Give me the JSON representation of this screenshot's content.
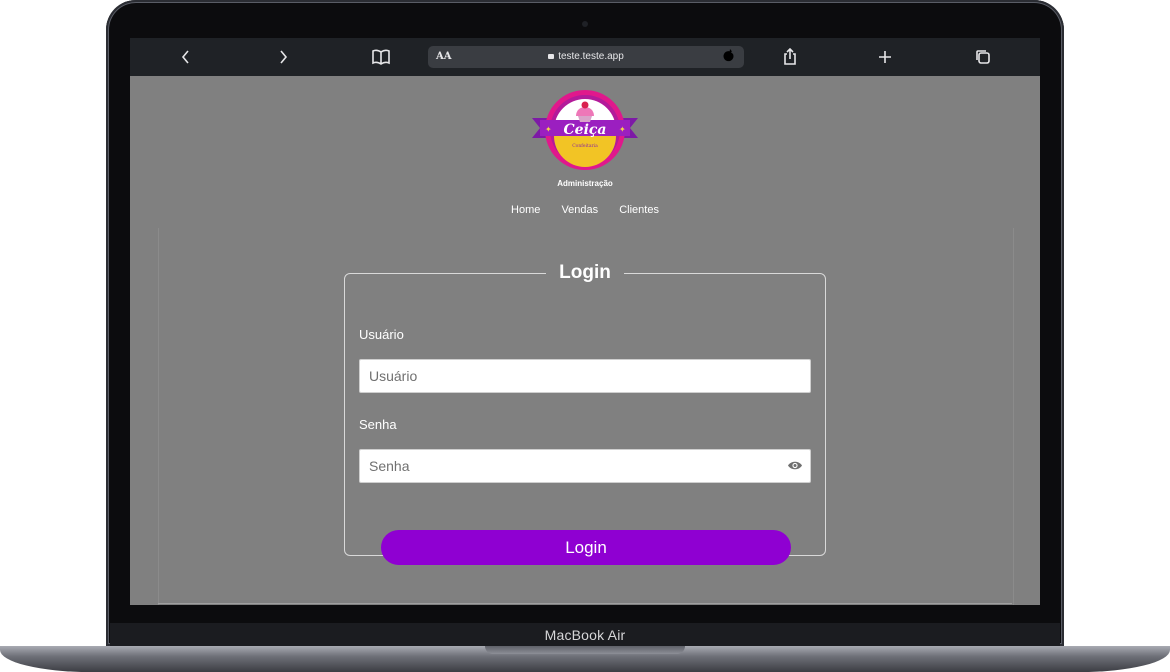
{
  "device": {
    "model_label": "MacBook Air"
  },
  "browser": {
    "text_size_label": "AA",
    "url": "teste.teste.app",
    "icons": {
      "back": "chevron-left-icon",
      "forward": "chevron-right-icon",
      "bookmarks": "book-icon",
      "secure": "lock-icon",
      "reload": "reload-icon",
      "share": "share-icon",
      "new_tab": "plus-icon",
      "tabs": "tabs-icon"
    }
  },
  "header": {
    "logo_text": "Ceiça",
    "logo_subtext": "Confeitaria",
    "title": "Administração"
  },
  "nav": {
    "items": [
      {
        "label": "Home"
      },
      {
        "label": "Vendas"
      },
      {
        "label": "Clientes"
      }
    ]
  },
  "login": {
    "legend": "Login",
    "username_label": "Usuário",
    "username_placeholder": "Usuário",
    "password_label": "Senha",
    "password_placeholder": "Senha",
    "show_password_icon": "eye-icon",
    "submit_label": "Login"
  },
  "colors": {
    "page_background": "#808080",
    "button": "#8f00d2",
    "logo_ring": "#e0188c",
    "logo_ribbon": "#9b1fc0",
    "logo_accent": "#f2c425"
  }
}
